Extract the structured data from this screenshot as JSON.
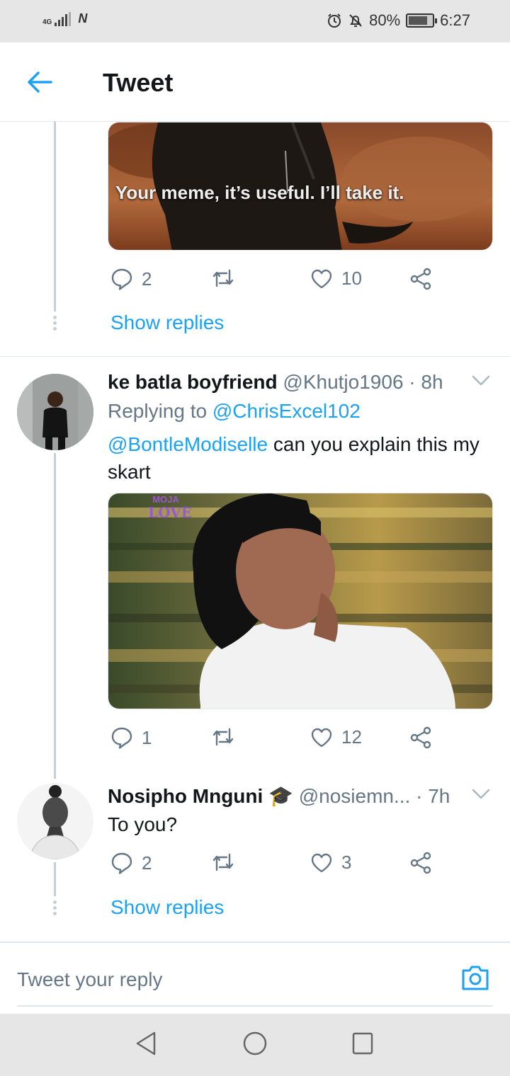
{
  "status_bar": {
    "network": "4G",
    "battery": "80%",
    "battery_level": 0.8,
    "time": "6:27"
  },
  "header": {
    "title": "Tweet"
  },
  "tweets": [
    {
      "media_caption": "Your meme, it’s useful. I’ll take it.",
      "replies": "2",
      "likes": "10",
      "show_replies": "Show replies"
    },
    {
      "name": "ke batla boyfriend",
      "handle": "@Khutjo1906",
      "time": "· 8h",
      "replying_prefix": "Replying to",
      "replying_to": "@ChrisExcel102",
      "mention": "@BontleModiselle",
      "text": " can you explain this my skart",
      "media_logo_top": "MOJA",
      "media_logo_bottom": "LOVE",
      "replies": "1",
      "likes": "12"
    },
    {
      "name": "Nosipho Mnguni",
      "name_emoji": "🎓",
      "handle": "@nosiemn...",
      "time": "· 7h",
      "text": "To you?",
      "replies": "2",
      "likes": "3",
      "show_replies": "Show replies"
    }
  ],
  "reply_bar": {
    "placeholder": "Tweet your reply"
  },
  "colors": {
    "accent": "#1da1f2",
    "muted": "#657786",
    "text": "#14171a"
  }
}
